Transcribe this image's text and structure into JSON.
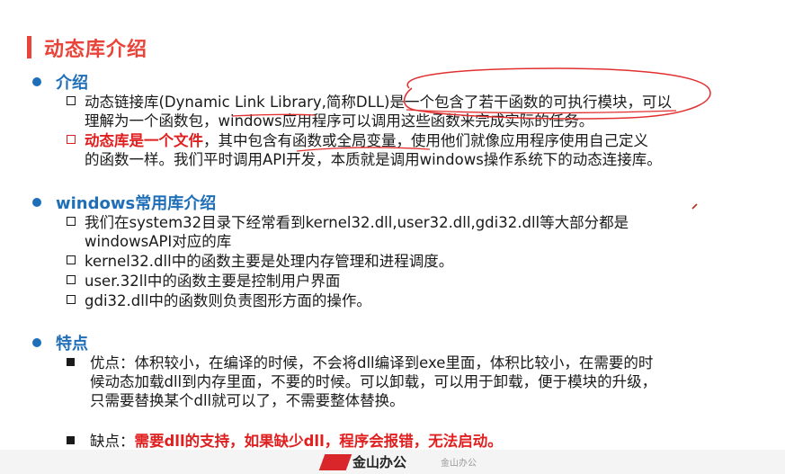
{
  "title": "动态库介绍",
  "sections": {
    "intro": {
      "heading": "介绍",
      "items": [
        {
          "line1": "动态链接库(Dynamic Link Library,简称DLL)是一个包含了若干函数的可执行模块，可以",
          "line2": "理解为一个函数包，windows应用程序可以调用这些函数来完成实际的任务。"
        },
        {
          "emph": "动态库是一个文件",
          "line1_rest": "，其中包含有函数或全局变量，使用他们就像应用程序使用自己定义",
          "line2": "的函数一样。我们平时调用API开发，本质就是调用windows操作系统下的动态连接库。"
        }
      ]
    },
    "libs": {
      "heading": "windows常用库介绍",
      "items": [
        {
          "line1": "我们在system32目录下经常看到kernel32.dll,user32.dll,gdi32.dll等大部分都是",
          "line2": "windowsAPI对应的库"
        },
        {
          "line1": "kernel32.dll中的函数主要是处理内存管理和进程调度。"
        },
        {
          "line1": "user.32ll中的函数主要是控制用户界面"
        },
        {
          "line1": "gdi32.dll中的函数则负责图形方面的操作。"
        }
      ]
    },
    "features": {
      "heading": "特点",
      "pros": {
        "line1": "优点：体积较小，在编译的时候，不会将dll编译到exe里面，体积比较小，在需要的时",
        "line2": "候动态加载dll到内存里面，不要的时候。可以卸载，可以用于卸载，便于模块的升级，",
        "line3": "只需要替换某个dll就可以了，不需要整体替换。"
      },
      "cons": {
        "label": "缺点：",
        "emph": "需要dll的支持，如果缺少dll，程序会报错，无法启动。"
      }
    }
  },
  "footer": {
    "logo_text": "金山办公",
    "sub_text": "金山办公"
  },
  "colors": {
    "accent_red": "#e8443a",
    "heading_blue": "#1f6fb8",
    "emphasis_red": "#e02020"
  }
}
